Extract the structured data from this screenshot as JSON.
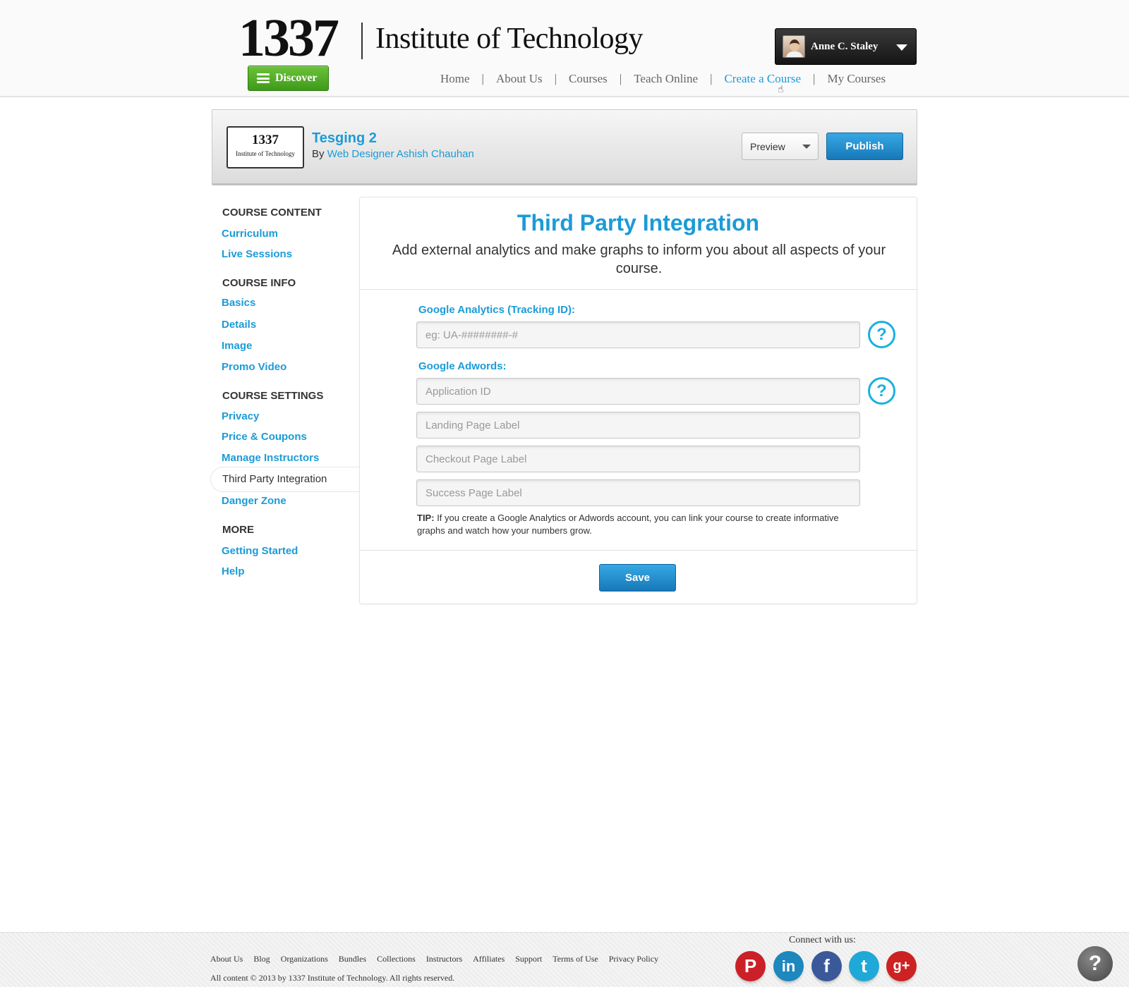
{
  "header": {
    "logo_number": "1337",
    "logo_text": "Institute of Technology",
    "discover_label": "Discover",
    "user_name": "Anne C. Staley",
    "nav": [
      "Home",
      "About Us",
      "Courses",
      "Teach Online",
      "Create a Course",
      "My Courses"
    ],
    "nav_active": "Create a Course"
  },
  "course": {
    "thumb_line1": "1337",
    "thumb_line2": "Institute of Technology",
    "title": "Tesging 2",
    "by_prefix": "By",
    "author": "Web Designer Ashish Chauhan",
    "preview_label": "Preview",
    "publish_label": "Publish"
  },
  "sidebar": {
    "course_content": "COURSE CONTENT",
    "curriculum": "Curriculum",
    "live_sessions": "Live Sessions",
    "course_info": "COURSE INFO",
    "basics": "Basics",
    "details": "Details",
    "image": "Image",
    "promo_video": "Promo Video",
    "course_settings": "COURSE SETTINGS",
    "privacy": "Privacy",
    "price_coupons": "Price & Coupons",
    "manage_instructors": "Manage Instructors",
    "third_party": "Third Party Integration",
    "danger_zone": "Danger Zone",
    "more": "MORE",
    "getting_started": "Getting Started",
    "help": "Help"
  },
  "panel": {
    "title": "Third Party Integration",
    "subtitle": "Add external analytics and make graphs to inform you about all aspects of your course.",
    "ga_label": "Google Analytics (Tracking ID):",
    "ga_placeholder": "eg: UA-########-#",
    "adwords_label": "Google Adwords:",
    "app_id_placeholder": "Application ID",
    "landing_placeholder": "Landing Page Label",
    "checkout_placeholder": "Checkout Page Label",
    "success_placeholder": "Success Page Label",
    "tip_prefix": "TIP:",
    "tip_text": "If you create a Google Analytics or Adwords account, you can link your course to create informative graphs and watch how your numbers grow.",
    "save_label": "Save"
  },
  "footer": {
    "links": [
      "About Us",
      "Blog",
      "Organizations",
      "Bundles",
      "Collections",
      "Instructors",
      "Affiliates",
      "Support",
      "Terms of Use",
      "Privacy Policy"
    ],
    "copyright": "All content © 2013 by 1337 Institute of Technology. All rights reserved.",
    "connect": "Connect with us:",
    "social": [
      {
        "icon": "pinterest-icon",
        "glyph": "P",
        "color": "#cb2027"
      },
      {
        "icon": "linkedin-icon",
        "glyph": "in",
        "color": "#1d87be"
      },
      {
        "icon": "facebook-icon",
        "glyph": "f",
        "color": "#3b5998"
      },
      {
        "icon": "twitter-icon",
        "glyph": "t",
        "color": "#1fa8d8"
      },
      {
        "icon": "google-plus-icon",
        "glyph": "g+",
        "color": "#cc2222"
      }
    ],
    "help_fab": "?"
  },
  "colors": {
    "accent": "#1b9bd7",
    "discover_green": "#4ea82a",
    "publish_blue": "#1e88c8"
  }
}
